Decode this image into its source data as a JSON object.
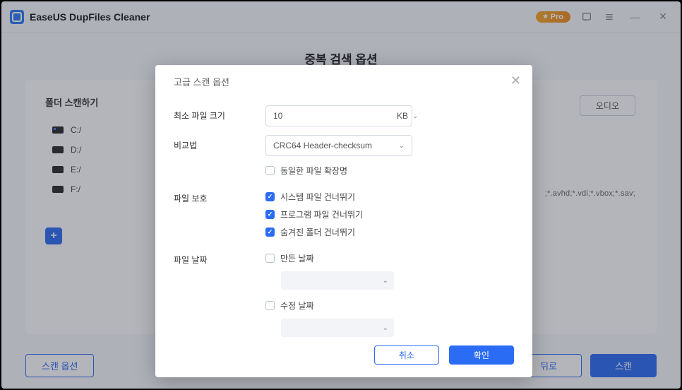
{
  "app": {
    "title": "EaseUS DupFiles Cleaner",
    "pro_badge": "Pro"
  },
  "page": {
    "title": "중복 검색 옵션"
  },
  "sidebar": {
    "label": "폴더 스캔하기",
    "drives": [
      "C:/",
      "D:/",
      "E:/",
      "F:/"
    ]
  },
  "right_chip": "오디오",
  "ext_text": ";*.avhd;*.vdi;*.vbox;*.sav;",
  "footer": {
    "options": "스캔 옵션",
    "back": "뒤로",
    "scan": "스캔"
  },
  "modal": {
    "title": "고급 스캔 옵션",
    "labels": {
      "min_size": "최소 파일 크기",
      "compare": "비교법",
      "protect": "파일 보호",
      "date": "파일 날짜"
    },
    "min_size": {
      "value": "10",
      "unit": "KB"
    },
    "compare_method": "CRC64 Header-checksum",
    "same_ext": "동일한 파일 확장명",
    "protect": {
      "skip_system": "시스템 파일 건너뛰기",
      "skip_program": "프로그램 파일 건너뛰기",
      "skip_hidden": "숨겨진 폴더 건너뛰기"
    },
    "date": {
      "created": "만든 날짜",
      "modified": "수정 날짜"
    },
    "buttons": {
      "cancel": "취소",
      "ok": "확인"
    }
  }
}
